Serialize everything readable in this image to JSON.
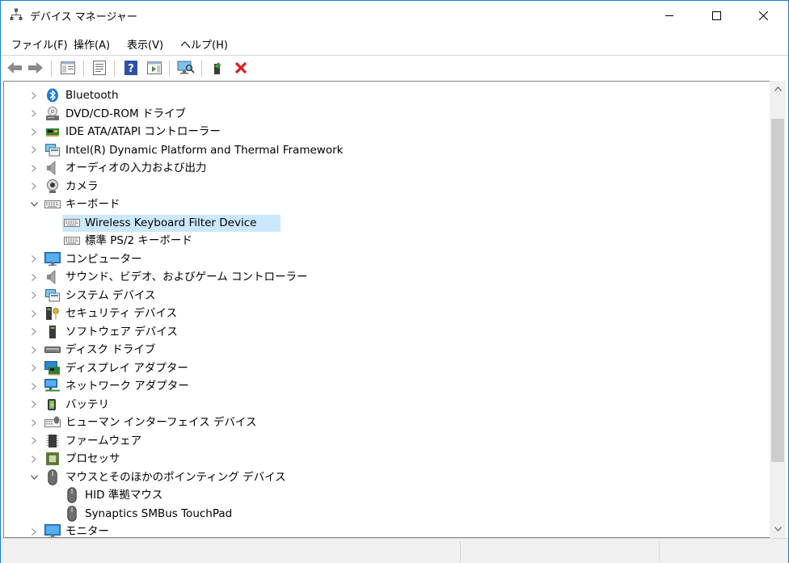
{
  "window": {
    "title": "デバイス マネージャー",
    "accent": "#1e7bd1"
  },
  "menu": [
    {
      "label": "ファイル(F)"
    },
    {
      "label": "操作(A)"
    },
    {
      "label": "表示(V)"
    },
    {
      "label": "ヘルプ(H)"
    }
  ],
  "toolbar": {
    "buttons": [
      "back-icon",
      "forward-icon",
      "show-hide-console-tree-icon",
      "properties-icon",
      "help-icon",
      "action-pane-icon",
      "scan-hardware-icon",
      "update-driver-icon",
      "uninstall-device-icon"
    ]
  },
  "tree": {
    "selected_color": "#cce8ff",
    "items": [
      {
        "label": "Bluetooth",
        "icon": "bluetooth-icon",
        "expanded": false,
        "level": 0
      },
      {
        "label": "DVD/CD-ROM ドライブ",
        "icon": "dvd-drive-icon",
        "expanded": false,
        "level": 0
      },
      {
        "label": "IDE ATA/ATAPI コントローラー",
        "icon": "ide-controller-icon",
        "expanded": false,
        "level": 0
      },
      {
        "label": "Intel(R) Dynamic Platform and Thermal Framework",
        "icon": "system-device-icon",
        "expanded": false,
        "level": 0
      },
      {
        "label": "オーディオの入力および出力",
        "icon": "speaker-icon",
        "expanded": false,
        "level": 0
      },
      {
        "label": "カメラ",
        "icon": "camera-icon",
        "expanded": false,
        "level": 0
      },
      {
        "label": "キーボード",
        "icon": "keyboard-icon",
        "expanded": true,
        "level": 0
      },
      {
        "label": "Wireless Keyboard Filter Device",
        "icon": "keyboard-icon",
        "level": 1,
        "selected": true
      },
      {
        "label": "標準 PS/2 キーボード",
        "icon": "keyboard-icon",
        "level": 1
      },
      {
        "label": "コンピューター",
        "icon": "monitor-icon",
        "expanded": false,
        "level": 0
      },
      {
        "label": "サウンド、ビデオ、およびゲーム コントローラー",
        "icon": "speaker-icon",
        "expanded": false,
        "level": 0
      },
      {
        "label": "システム デバイス",
        "icon": "system-device-icon",
        "expanded": false,
        "level": 0
      },
      {
        "label": "セキュリティ デバイス",
        "icon": "security-key-icon",
        "expanded": false,
        "level": 0
      },
      {
        "label": "ソフトウェア デバイス",
        "icon": "software-device-icon",
        "expanded": false,
        "level": 0
      },
      {
        "label": "ディスク ドライブ",
        "icon": "disk-drive-icon",
        "expanded": false,
        "level": 0
      },
      {
        "label": "ディスプレイ アダプター",
        "icon": "display-adapter-icon",
        "expanded": false,
        "level": 0
      },
      {
        "label": "ネットワーク アダプター",
        "icon": "network-adapter-icon",
        "expanded": false,
        "level": 0
      },
      {
        "label": "バッテリ",
        "icon": "battery-icon",
        "expanded": false,
        "level": 0
      },
      {
        "label": "ヒューマン インターフェイス デバイス",
        "icon": "hid-icon",
        "expanded": false,
        "level": 0
      },
      {
        "label": "ファームウェア",
        "icon": "firmware-icon",
        "expanded": false,
        "level": 0
      },
      {
        "label": "プロセッサ",
        "icon": "processor-icon",
        "expanded": false,
        "level": 0
      },
      {
        "label": "マウスとそのほかのポインティング デバイス",
        "icon": "mouse-icon",
        "expanded": true,
        "level": 0
      },
      {
        "label": "HID 準拠マウス",
        "icon": "mouse-icon",
        "level": 1
      },
      {
        "label": "Synaptics SMBus TouchPad",
        "icon": "mouse-icon",
        "level": 1
      },
      {
        "label": "モニター",
        "icon": "monitor-icon",
        "expanded": false,
        "level": 0
      }
    ]
  }
}
